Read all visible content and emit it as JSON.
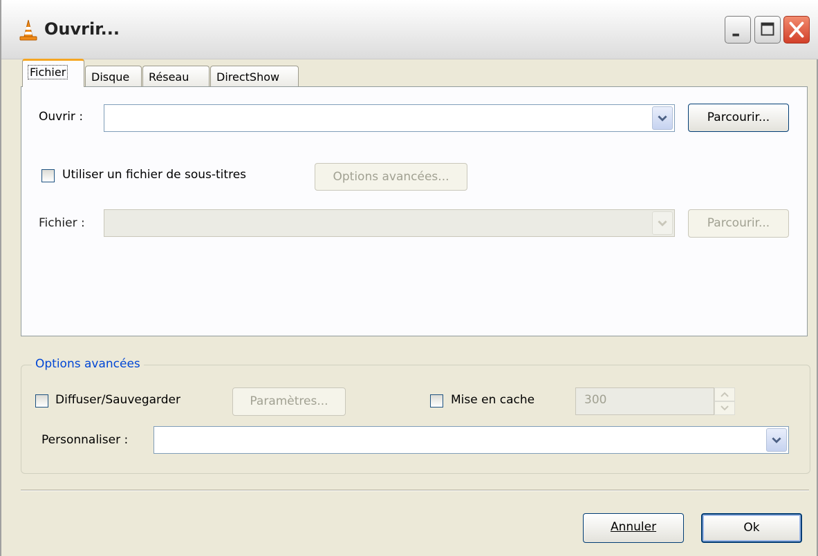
{
  "window": {
    "title": "Ouvrir...",
    "icon": "vlc-cone-icon",
    "controls": [
      "minimize",
      "maximize",
      "close"
    ]
  },
  "tabs": [
    {
      "label": "Fichier",
      "active": true
    },
    {
      "label": "Disque",
      "active": false
    },
    {
      "label": "Réseau",
      "active": false
    },
    {
      "label": "DirectShow",
      "active": false
    }
  ],
  "file_tab": {
    "open_label": "Ouvrir :",
    "open_value": "",
    "browse_label": "Parcourir...",
    "subtitle_checkbox_label": "Utiliser un fichier de sous-titres",
    "subtitle_checked": false,
    "advanced_options_button": "Options avancées...",
    "subtitle_file_label": "Fichier :",
    "subtitle_file_value": "",
    "subtitle_browse_label": "Parcourir..."
  },
  "advanced": {
    "group_title": "Options avancées",
    "stream_checkbox_label": "Diffuser/Sauvegarder",
    "stream_checked": false,
    "settings_button": "Paramètres...",
    "cache_checkbox_label": "Mise en cache",
    "cache_checked": false,
    "cache_value": "300",
    "customize_label": "Personnaliser :",
    "customize_value": ""
  },
  "footer": {
    "cancel_label": "Annuler",
    "ok_label": "Ok"
  }
}
